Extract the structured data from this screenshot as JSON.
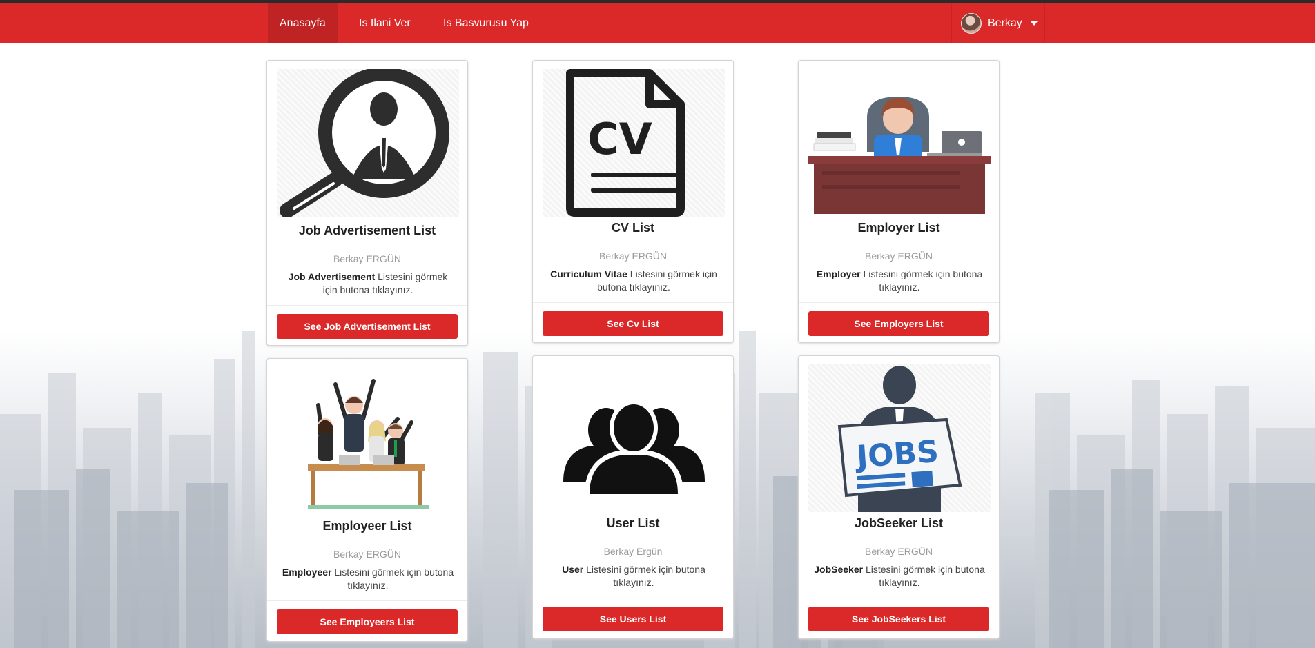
{
  "nav": {
    "items": [
      {
        "label": "Anasayfa",
        "active": true
      },
      {
        "label": "Is Ilani Ver",
        "active": false
      },
      {
        "label": "Is Basvurusu Yap",
        "active": false
      }
    ],
    "user": {
      "name": "Berkay"
    },
    "accent": "#db2828"
  },
  "cards": [
    {
      "title": "Job Advertisement List",
      "author": "Berkay ERGÜN",
      "desc_bold": "Job Advertisement",
      "desc_rest": " Listesini görmek için butona tıklayınız.",
      "button": "See Job Advertisement List",
      "icon": "job-search-icon"
    },
    {
      "title": "CV List",
      "author": "Berkay ERGÜN",
      "desc_bold": "Curriculum Vitae",
      "desc_rest": " Listesini görmek için butona tıklayınız.",
      "button": "See Cv List",
      "icon": "cv-document-icon"
    },
    {
      "title": "Employer List",
      "author": "Berkay ERGÜN",
      "desc_bold": "Employer",
      "desc_rest": " Listesini görmek için butona tıklayınız.",
      "button": "See Employers List",
      "icon": "employer-desk-icon"
    },
    {
      "title": "Employeer List",
      "author": "Berkay ERGÜN",
      "desc_bold": "Employeer",
      "desc_rest": " Listesini görmek için butona tıklayınız.",
      "button": "See Employeers List",
      "icon": "team-celebrate-icon"
    },
    {
      "title": "User List",
      "author": "Berkay Ergün",
      "desc_bold": "User",
      "desc_rest": " Listesini görmek için butona tıklayınız.",
      "button": "See Users List",
      "icon": "users-group-icon"
    },
    {
      "title": "JobSeeker List",
      "author": "Berkay ERGÜN",
      "desc_bold": "JobSeeker",
      "desc_rest": " Listesini görmek için butona tıklayınız.",
      "button": "See JobSeekers List",
      "icon": "jobseeker-newspaper-icon",
      "icon_text": "JOBS"
    }
  ]
}
